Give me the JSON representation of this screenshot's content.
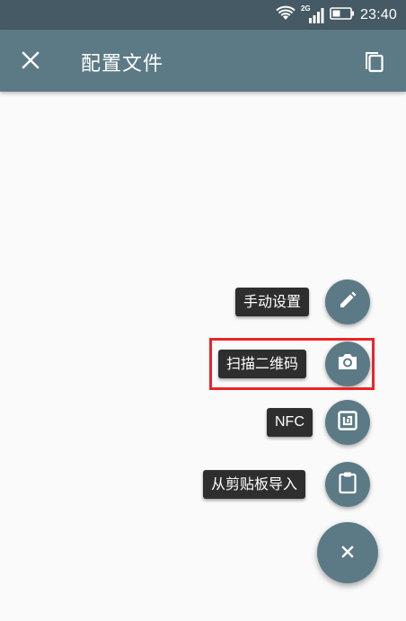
{
  "status_bar": {
    "network": "2G",
    "time": "23:40",
    "icons": [
      "wifi-icon",
      "signal-icon",
      "battery-icon"
    ]
  },
  "toolbar": {
    "title": "配置文件",
    "close_icon": "close-icon",
    "copy_icon": "copy-icon"
  },
  "fab_menu": {
    "items": [
      {
        "label": "手动设置",
        "icon": "pencil-icon"
      },
      {
        "label": "扫描二维码",
        "icon": "camera-icon"
      },
      {
        "label": "NFC",
        "icon": "nfc-icon"
      },
      {
        "label": "从剪贴板导入",
        "icon": "clipboard-icon"
      }
    ],
    "main_icon": "close-icon"
  },
  "colors": {
    "status_bar": "#455a64",
    "toolbar": "#5c7a85",
    "fab": "#5c7a85",
    "label_bg": "#2e2e2e",
    "background": "#fafafa",
    "highlight": "#e8262a"
  }
}
